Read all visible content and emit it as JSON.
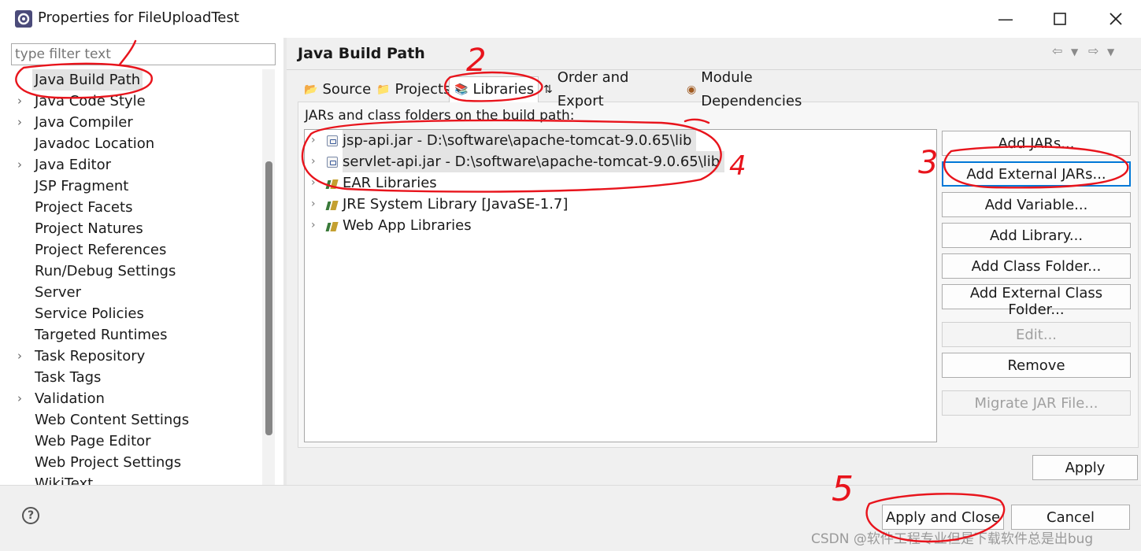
{
  "window": {
    "title": "Properties for FileUploadTest",
    "minimize_icon": "minimize-icon",
    "maximize_icon": "maximize-icon",
    "close_icon": "close-icon"
  },
  "filter": {
    "placeholder": "type filter text"
  },
  "tree": {
    "items": [
      {
        "label": "Java Build Path",
        "expandable": false,
        "selected": true
      },
      {
        "label": "Java Code Style",
        "expandable": true
      },
      {
        "label": "Java Compiler",
        "expandable": true
      },
      {
        "label": "Javadoc Location",
        "expandable": false
      },
      {
        "label": "Java Editor",
        "expandable": true
      },
      {
        "label": "JSP Fragment",
        "expandable": false
      },
      {
        "label": "Project Facets",
        "expandable": false
      },
      {
        "label": "Project Natures",
        "expandable": false
      },
      {
        "label": "Project References",
        "expandable": false
      },
      {
        "label": "Run/Debug Settings",
        "expandable": false
      },
      {
        "label": "Server",
        "expandable": false
      },
      {
        "label": "Service Policies",
        "expandable": false
      },
      {
        "label": "Targeted Runtimes",
        "expandable": false
      },
      {
        "label": "Task Repository",
        "expandable": true
      },
      {
        "label": "Task Tags",
        "expandable": false
      },
      {
        "label": "Validation",
        "expandable": true
      },
      {
        "label": "Web Content Settings",
        "expandable": false
      },
      {
        "label": "Web Page Editor",
        "expandable": false
      },
      {
        "label": "Web Project Settings",
        "expandable": false
      },
      {
        "label": "WikiText",
        "expandable": false
      }
    ]
  },
  "page": {
    "title": "Java Build Path"
  },
  "tabs": [
    {
      "label": "Source",
      "icon": "source-folder-icon"
    },
    {
      "label": "Projects",
      "icon": "projects-icon"
    },
    {
      "label": "Libraries",
      "icon": "libraries-icon",
      "active": true
    },
    {
      "label": "Order and Export",
      "icon": "order-export-icon"
    },
    {
      "label": "Module Dependencies",
      "icon": "module-icon"
    }
  ],
  "libraries": {
    "label": "JARs and class folders on the build path:",
    "rows": [
      {
        "text": "jsp-api.jar - D:\\software\\apache-tomcat-9.0.65\\lib",
        "kind": "jar",
        "highlight": true
      },
      {
        "text": "servlet-api.jar - D:\\software\\apache-tomcat-9.0.65\\lib",
        "kind": "jar",
        "highlight": true
      },
      {
        "text": "EAR Libraries",
        "kind": "lib"
      },
      {
        "text": "JRE System Library [JavaSE-1.7]",
        "kind": "lib"
      },
      {
        "text": "Web App Libraries",
        "kind": "lib"
      }
    ]
  },
  "buttons": {
    "add_jars": "Add JARs...",
    "add_external_jars": "Add External JARs...",
    "add_variable": "Add Variable...",
    "add_library": "Add Library...",
    "add_class_folder": "Add Class Folder...",
    "add_external_class_folder": "Add External Class Folder...",
    "edit": "Edit...",
    "remove": "Remove",
    "migrate_jar": "Migrate JAR File...",
    "apply": "Apply",
    "apply_and_close": "Apply and Close",
    "cancel": "Cancel",
    "help": "?"
  },
  "annotations": [
    "1",
    "2",
    "3",
    "3",
    "4",
    "5"
  ],
  "watermark": "CSDN @软件工程专业但是下载软件总是出bug"
}
